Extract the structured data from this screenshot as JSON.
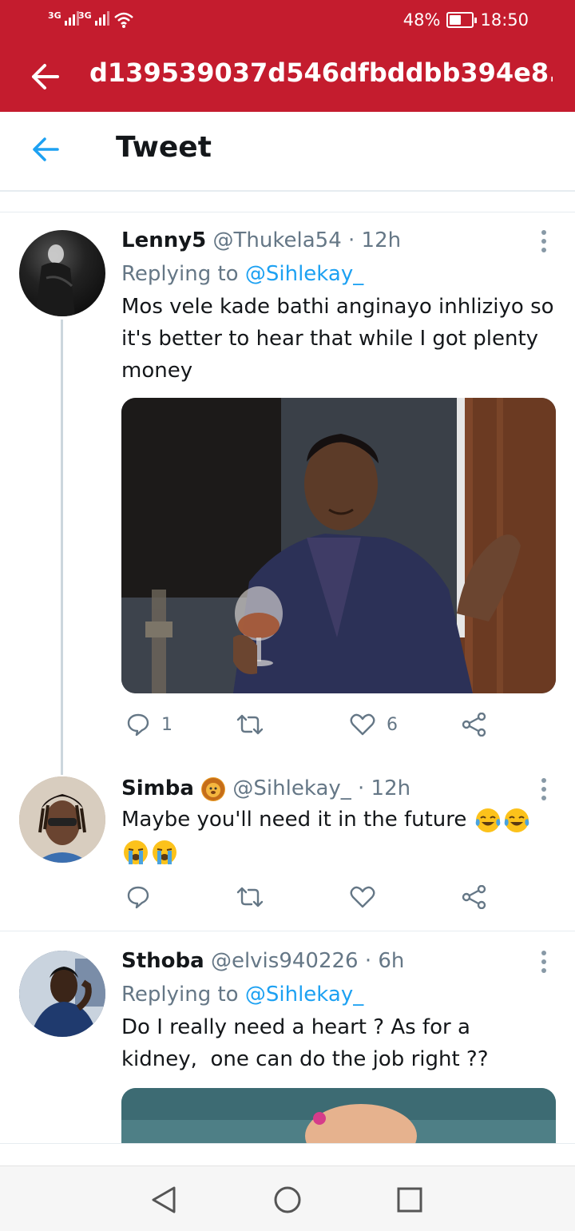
{
  "status_bar": {
    "network1": "3G",
    "network2": "3G",
    "battery_percent": "48%",
    "time": "18:50",
    "battery_level": 0.48
  },
  "app_bar": {
    "title": "d139539037d546dfbddbb394e8..."
  },
  "tweet_header": {
    "title": "Tweet"
  },
  "colors": {
    "app_bar": "#c41c2e",
    "link": "#1da1f2",
    "secondary_text": "#657786",
    "primary_text": "#14171a"
  },
  "tweets": [
    {
      "name": "Lenny5",
      "handle": "@Thukela54 · 12h",
      "replying_prefix": "Replying to ",
      "replying_to": "@Sihlekay_",
      "text": "Mos vele kade bathi anginayo inhliziyo so it's better to hear that while I got plenty money",
      "reply_count": "1",
      "like_count": "6",
      "icons": [
        "reply-icon",
        "retweet-icon",
        "like-icon",
        "share-icon"
      ]
    },
    {
      "name": "Simba",
      "name_emoji": "lion-emoji",
      "handle": "@Sihlekay_ · 12h",
      "text": "Maybe you'll need it in the future",
      "emojis": [
        "tears-of-joy-emoji",
        "tears-of-joy-emoji",
        "loudly-crying-emoji",
        "loudly-crying-emoji"
      ]
    },
    {
      "name": "Sthoba",
      "handle": "@elvis940226 · 6h",
      "replying_prefix": "Replying to ",
      "replying_to": "@Sihlekay_",
      "text_line1": "Do I really need a heart ? As for a",
      "text_line2": "kidney,  one can do the job right ??"
    }
  ],
  "nav_bar": {
    "icons": [
      "back-triangle-icon",
      "home-circle-icon",
      "recents-square-icon"
    ]
  }
}
